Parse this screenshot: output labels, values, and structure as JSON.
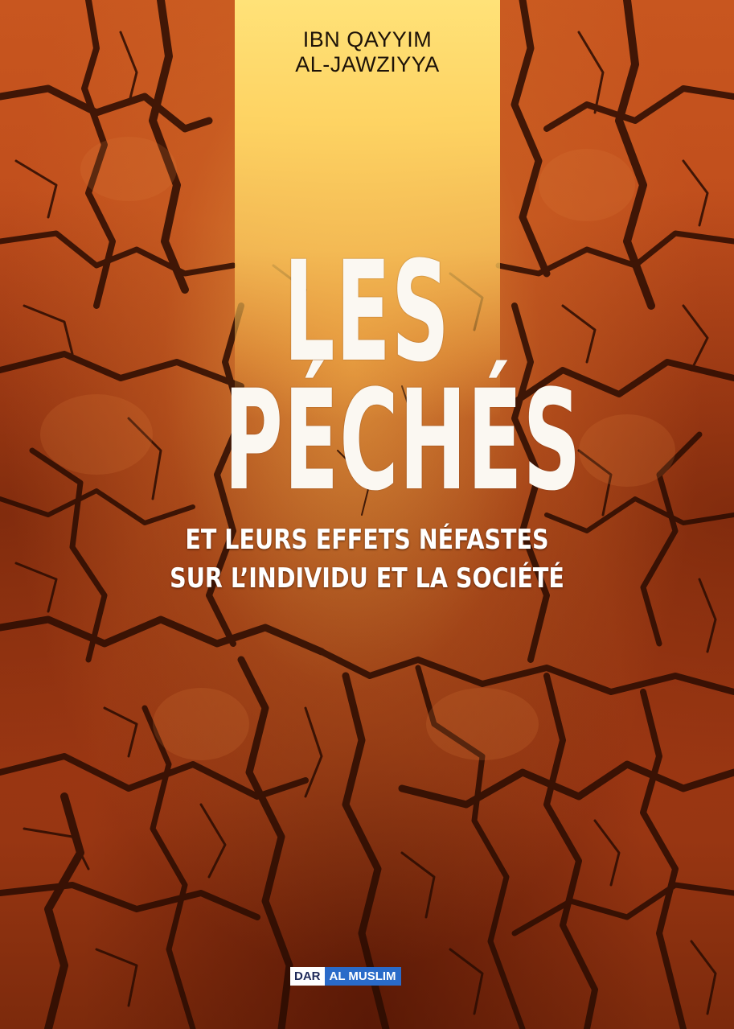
{
  "cover": {
    "author_line1": "IBN QAYYIM",
    "author_line2": "AL-JAWZIYYA",
    "title_line1": "LES",
    "title_line2": "PÉCHÉS",
    "subtitle_line1": "ET LEURS EFFETS NÉFASTES",
    "subtitle_line2": "SUR L’INDIVIDU ET LA SOCIÉTÉ",
    "publisher_part1": "DAR",
    "publisher_part2": "AL MUSLIM"
  },
  "colors": {
    "earth": "#b9471a",
    "highlight_band": "#ffd664",
    "title_text": "#fbf8f2",
    "publisher_blue": "#2a6bc9"
  }
}
